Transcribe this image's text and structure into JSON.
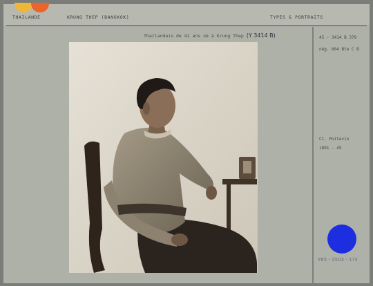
{
  "header": {
    "country": "THAILANDE",
    "place": "KRUNG THEP (BANGKOK)",
    "category": "TYPES & PORTRAITS"
  },
  "caption": {
    "text": "Thaïlandais de 41 ans né à Krung Thep",
    "handwritten_ref": "(Y 3414 B)"
  },
  "sidebar": {
    "inventory": "45 - 3414 B 379",
    "neg": "nég. 804 Bte C B",
    "credit": "Cl. Poitevin",
    "dates": "1891 - 45",
    "bottom_ref": "Y65 - 3503 - 1?3"
  },
  "colors": {
    "accent_yellow": "#f0b63a",
    "accent_orange": "#e9652a",
    "blue_dot": "#1c2ee0"
  }
}
